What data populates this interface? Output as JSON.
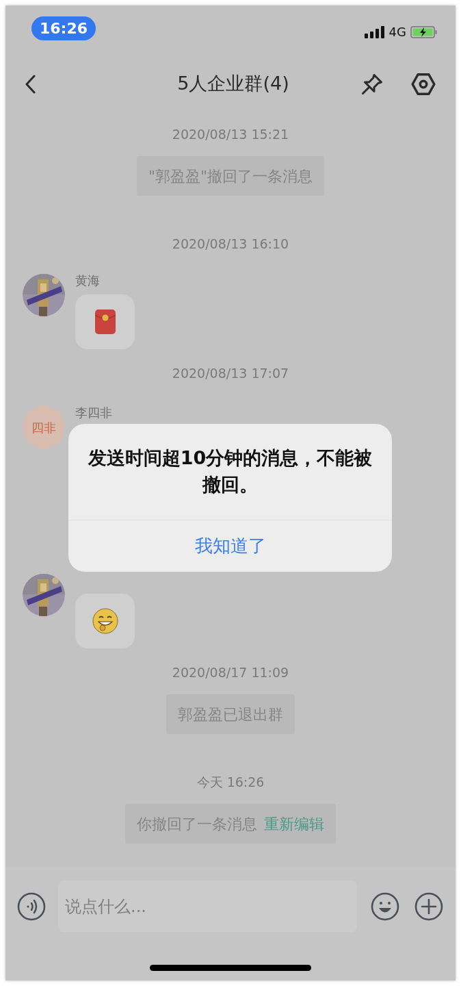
{
  "status_bar": {
    "time": "16:26",
    "network": "4G"
  },
  "header": {
    "title": "5人企业群(4)"
  },
  "messages": [
    {
      "kind": "timestamp",
      "text": "2020/08/13 15:21"
    },
    {
      "kind": "notice",
      "text": "\"郭盈盈\"撤回了一条消息"
    },
    {
      "kind": "timestamp",
      "text": "2020/08/13 16:10"
    },
    {
      "kind": "received",
      "sender": "黄海",
      "attachment": {
        "kind": "red_packet"
      }
    },
    {
      "kind": "timestamp",
      "text": "2020/08/13 17:07"
    },
    {
      "kind": "received",
      "sender": "李四非",
      "avatar": {
        "kind": "initials",
        "text": "四非"
      }
    },
    {
      "kind": "received",
      "attachment": {
        "kind": "emoji"
      }
    },
    {
      "kind": "timestamp",
      "text": "2020/08/17 11:09"
    },
    {
      "kind": "notice",
      "text": "郭盈盈已退出群"
    },
    {
      "kind": "timestamp",
      "text": "今天 16:26"
    },
    {
      "kind": "notice",
      "text": "你撤回了一条消息",
      "link": "重新编辑"
    }
  ],
  "dialog": {
    "message": "发送时间超10分钟的消息，不能被撤回。",
    "button": "我知道了"
  },
  "input": {
    "placeholder": "说点什么..."
  }
}
